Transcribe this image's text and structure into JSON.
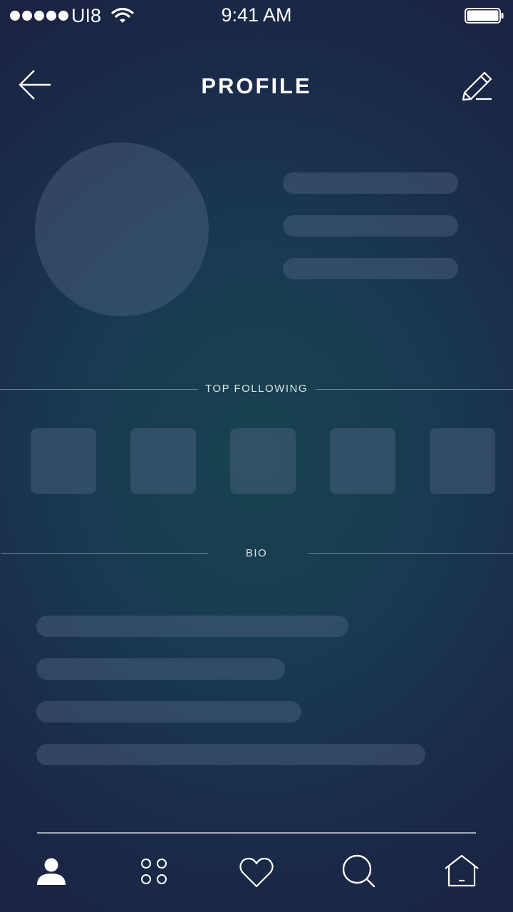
{
  "status_bar": {
    "carrier": "UI8",
    "time": "9:41 AM",
    "signal_bars": 5
  },
  "header": {
    "title": "PROFILE",
    "back_icon": "arrow-left-icon",
    "edit_icon": "pencil-icon"
  },
  "sections": {
    "top_following": {
      "label": "TOP FOLLOWING",
      "count": 5
    },
    "bio": {
      "label": "BIO"
    }
  },
  "tab_bar": {
    "tabs": [
      {
        "icon": "user-icon",
        "active": true
      },
      {
        "icon": "apps-grid-icon",
        "active": false
      },
      {
        "icon": "heart-icon",
        "active": false
      },
      {
        "icon": "search-icon",
        "active": false
      },
      {
        "icon": "home-icon",
        "active": false
      }
    ]
  },
  "colors": {
    "background_center": "#17434f",
    "background_edge": "#1b2342",
    "placeholder": "#455a73",
    "text": "#ffffff"
  }
}
